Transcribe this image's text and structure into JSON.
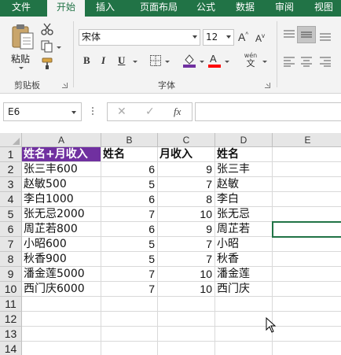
{
  "tabs": [
    {
      "label": "文件",
      "active": false
    },
    {
      "label": "开始",
      "active": true
    },
    {
      "label": "插入",
      "active": false
    },
    {
      "label": "页面布局",
      "active": false
    },
    {
      "label": "公式",
      "active": false
    },
    {
      "label": "数据",
      "active": false
    },
    {
      "label": "审阅",
      "active": false
    },
    {
      "label": "视图",
      "active": false
    }
  ],
  "ribbon": {
    "clipboard": {
      "paste_label": "粘贴",
      "group_label": "剪贴板"
    },
    "font": {
      "font_name": "宋体",
      "font_size": "12",
      "bold": "B",
      "italic": "I",
      "underline": "U",
      "pinyin_top": "wén",
      "pinyin_bottom": "文",
      "group_label": "字体"
    }
  },
  "formula_bar": {
    "name_box": "E6",
    "cancel_icon": "✕",
    "enter_icon": "✓",
    "fx_label": "fx",
    "content": ""
  },
  "sheet": {
    "columns": [
      "A",
      "B",
      "C",
      "D",
      "E"
    ],
    "row_numbers": [
      "1",
      "2",
      "3",
      "4",
      "5",
      "6",
      "7",
      "8",
      "9",
      "10",
      "11",
      "12",
      "13",
      "14"
    ],
    "header": [
      "姓名+月收入",
      "姓名",
      "月收入",
      "姓名"
    ],
    "rows": [
      [
        "张三丰600",
        "6",
        "9",
        "张三丰"
      ],
      [
        "赵敏500",
        "5",
        "7",
        "赵敏"
      ],
      [
        "李白1000",
        "6",
        "8",
        "李白"
      ],
      [
        "张无忌2000",
        "7",
        "10",
        "张无忌"
      ],
      [
        "周芷若800",
        "6",
        "9",
        "周芷若"
      ],
      [
        "小昭600",
        "5",
        "7",
        "小昭"
      ],
      [
        "秋香900",
        "5",
        "7",
        "秋香"
      ],
      [
        "潘金莲5000",
        "7",
        "10",
        "潘金莲"
      ],
      [
        "西门庆6000",
        "7",
        "10",
        "西门庆"
      ]
    ],
    "selected_cell": "E6"
  },
  "colors": {
    "accent": "#217346",
    "header_fill": "#7030a0"
  }
}
